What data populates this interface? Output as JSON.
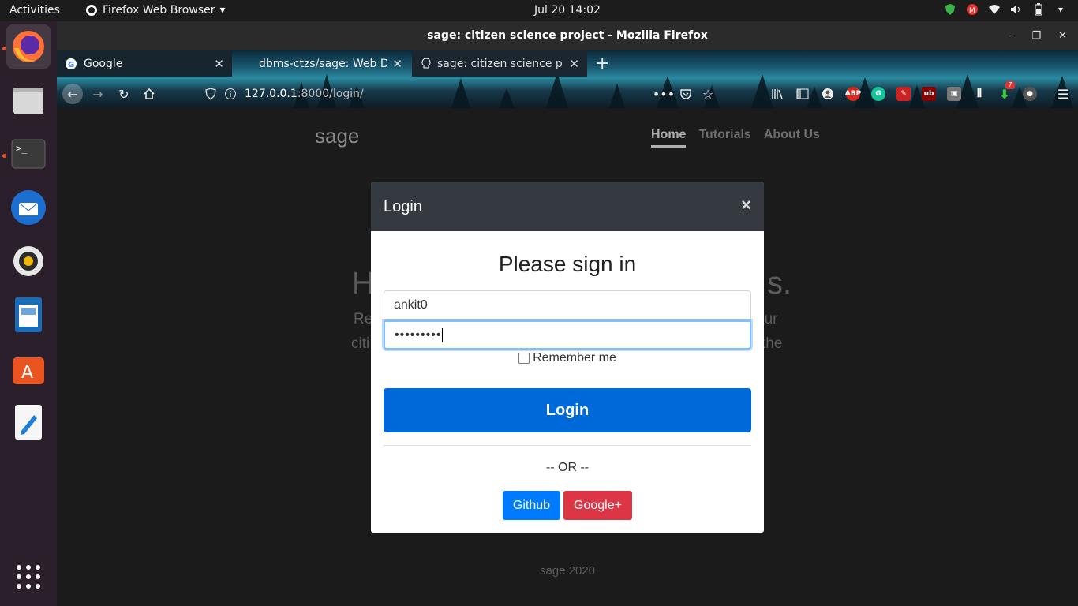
{
  "topbar": {
    "activities": "Activities",
    "app_menu": "Firefox Web Browser",
    "clock": "Jul 20  14:02"
  },
  "dock": {
    "items": [
      "firefox-icon",
      "files-icon",
      "terminal-icon",
      "thunderbird-icon",
      "rhythmbox-icon",
      "writer-icon",
      "software-center-icon",
      "text-editor-icon",
      "app-grid-icon"
    ]
  },
  "window": {
    "title": "sage: citizen science project - Mozilla Firefox"
  },
  "tabs": [
    {
      "label": "Google"
    },
    {
      "label": "dbms-ctzs/sage: Web De"
    },
    {
      "label": "sage: citizen science proj"
    }
  ],
  "urlbar": {
    "host": "127.0.0.1",
    "path": ":8000/login/"
  },
  "extensions": {
    "abp": "ABP",
    "ublock": "ub",
    "badge": "7"
  },
  "page": {
    "brand": "sage",
    "nav": {
      "home": "Home",
      "tutorials": "Tutorials",
      "about": "About Us"
    },
    "hero_left": "H",
    "hero_right": "s.",
    "para_l1": "Re",
    "para_l2": "citi",
    "para_r1": "our",
    "para_r2": "the",
    "footer": "sage 2020"
  },
  "modal": {
    "title": "Login",
    "close": "×",
    "heading": "Please sign in",
    "username": "ankit0",
    "password_mask": "•••••••••",
    "remember": "Remember me",
    "login_button": "Login",
    "or": "-- OR --",
    "github": "Github",
    "google": "Google+"
  },
  "colors": {
    "primary": "#0069d9",
    "github": "#007bff",
    "google": "#dc3545",
    "modal_header": "#343a40"
  }
}
